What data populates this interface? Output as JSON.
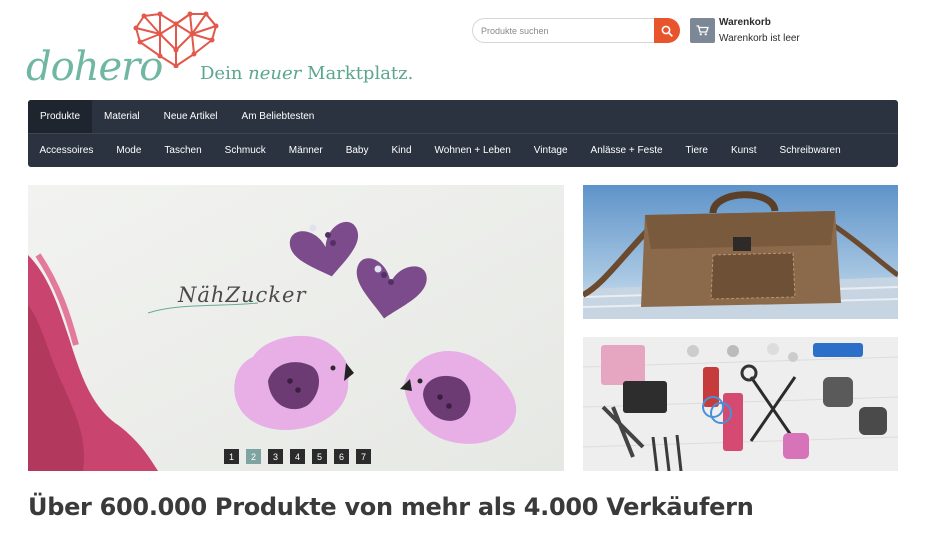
{
  "header": {
    "logo_text": "dohero",
    "tagline_before": "Dein",
    "tagline_em": "neuer",
    "tagline_after": "Marktplatz.",
    "search_placeholder": "Produkte suchen",
    "cart_title": "Warenkorb",
    "cart_status": "Warenkorb ist leer"
  },
  "nav": {
    "primary": [
      "Produkte",
      "Material",
      "Neue Artikel",
      "Am Beliebtesten"
    ],
    "secondary": [
      "Accessoires",
      "Mode",
      "Taschen",
      "Schmuck",
      "Männer",
      "Baby",
      "Kind",
      "Wohnen + Leben",
      "Vintage",
      "Anlässe + Feste",
      "Tiere",
      "Kunst",
      "Schreibwaren"
    ]
  },
  "slider": {
    "brand_text": "NähZucker",
    "pages": [
      "1",
      "2",
      "3",
      "4",
      "5",
      "6",
      "7"
    ],
    "active_page": 2
  },
  "headline": "Über 600.000 Produkte von mehr als 4.000 Verkäufern",
  "colors": {
    "accent": "#e8542c",
    "brand": "#6fb7a2",
    "nav_bg": "#2b3340",
    "nav_active": "#1e252f",
    "dot_active": "#7fa3a0"
  },
  "icons": {
    "search": "search-icon",
    "cart": "cart-icon",
    "logo_heart": "heart-network-icon"
  }
}
